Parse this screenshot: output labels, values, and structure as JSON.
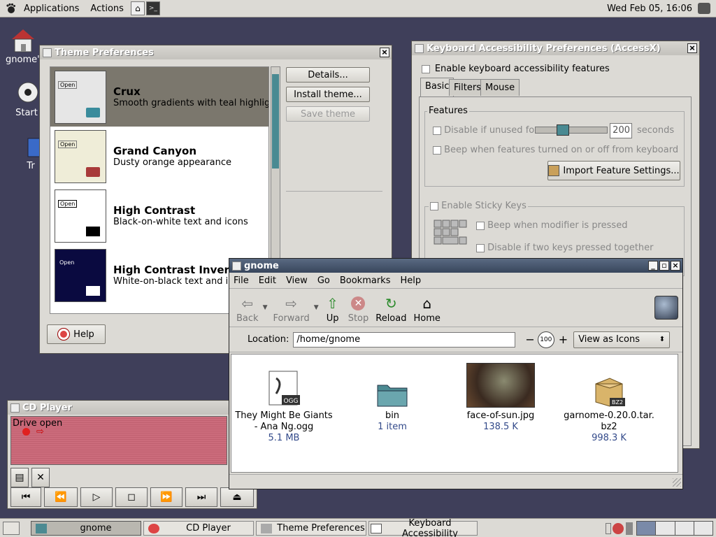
{
  "top_panel": {
    "menus": [
      "Applications",
      "Actions"
    ],
    "clock": "Wed Feb 05, 16:06"
  },
  "desktop": {
    "icons": [
      {
        "label": "gnome's"
      },
      {
        "label": "Start"
      },
      {
        "label": "Tr"
      }
    ]
  },
  "theme_prefs": {
    "title": "Theme Preferences",
    "themes": [
      {
        "name": "Crux",
        "desc": "Smooth gradients with teal highlight",
        "thumb_label": "Open",
        "selected": true
      },
      {
        "name": "Grand Canyon",
        "desc": "Dusty orange appearance",
        "thumb_label": "Open"
      },
      {
        "name": "High Contrast",
        "desc": "Black-on-white text and icons",
        "thumb_label": "Open"
      },
      {
        "name": "High Contrast Inverse",
        "desc": "White-on-black text and icons",
        "thumb_label": "Open"
      }
    ],
    "buttons": {
      "details": "Details...",
      "install": "Install theme...",
      "save": "Save theme",
      "help": "Help"
    }
  },
  "kbd_prefs": {
    "title": "Keyboard Accessibility Preferences (AccessX)",
    "enable_label": "Enable keyboard accessibility features",
    "tabs": [
      "Basic",
      "Filters",
      "Mouse"
    ],
    "features_label": "Features",
    "disable_unused_label": "Disable if unused for:",
    "disable_unused_value": "200",
    "seconds_label": "seconds",
    "beep_features_label": "Beep when features turned on or off from keyboard",
    "import_label": "Import Feature Settings...",
    "sticky_label": "Enable Sticky Keys",
    "beep_modifier_label": "Beep when modifier is pressed",
    "disable_two_keys_label": "Disable if two keys pressed together"
  },
  "nautilus": {
    "title": "gnome",
    "menus": [
      "File",
      "Edit",
      "View",
      "Go",
      "Bookmarks",
      "Help"
    ],
    "toolbar": [
      {
        "label": "Back",
        "icon": "back-arrow-icon",
        "enabled": false
      },
      {
        "label": "Forward",
        "icon": "forward-arrow-icon",
        "enabled": false
      },
      {
        "label": "Up",
        "icon": "up-arrow-icon",
        "enabled": true
      },
      {
        "label": "Stop",
        "icon": "stop-icon",
        "enabled": false
      },
      {
        "label": "Reload",
        "icon": "reload-icon",
        "enabled": true
      },
      {
        "label": "Home",
        "icon": "home-icon",
        "enabled": true
      }
    ],
    "location_label": "Location:",
    "location_value": "/home/gnome",
    "zoom": "100",
    "view_mode": "View as Icons",
    "files": [
      {
        "name_line1": "They Might Be Giants",
        "name_line2": "- Ana Ng.ogg",
        "info": "5.1 MB",
        "icon": "ogg-audio-icon",
        "badge": "OGG"
      },
      {
        "name_line1": "bin",
        "name_line2": "",
        "info": "1 item",
        "icon": "folder-icon"
      },
      {
        "name_line1": "face-of-sun.jpg",
        "name_line2": "",
        "info": "138.5 K",
        "icon": "image-thumbnail-icon"
      },
      {
        "name_line1": "garnome-0.20.0.tar.",
        "name_line2": "bz2",
        "info": "998.3 K",
        "icon": "archive-icon",
        "badge": "BZ2"
      }
    ]
  },
  "cd_player": {
    "title": "CD Player",
    "status": "Drive open"
  },
  "taskbar": {
    "tasks": [
      {
        "label": "gnome",
        "active": true
      },
      {
        "label": "CD Player",
        "active": false
      },
      {
        "label": "Theme Preferences",
        "active": false
      },
      {
        "label": "Keyboard Accessibility",
        "active": false
      }
    ]
  },
  "colors": {
    "desktop": "#3f3f5a",
    "selection": "#7b776d",
    "file_info": "#334a8a",
    "cd_display": "#cc6c7c"
  }
}
